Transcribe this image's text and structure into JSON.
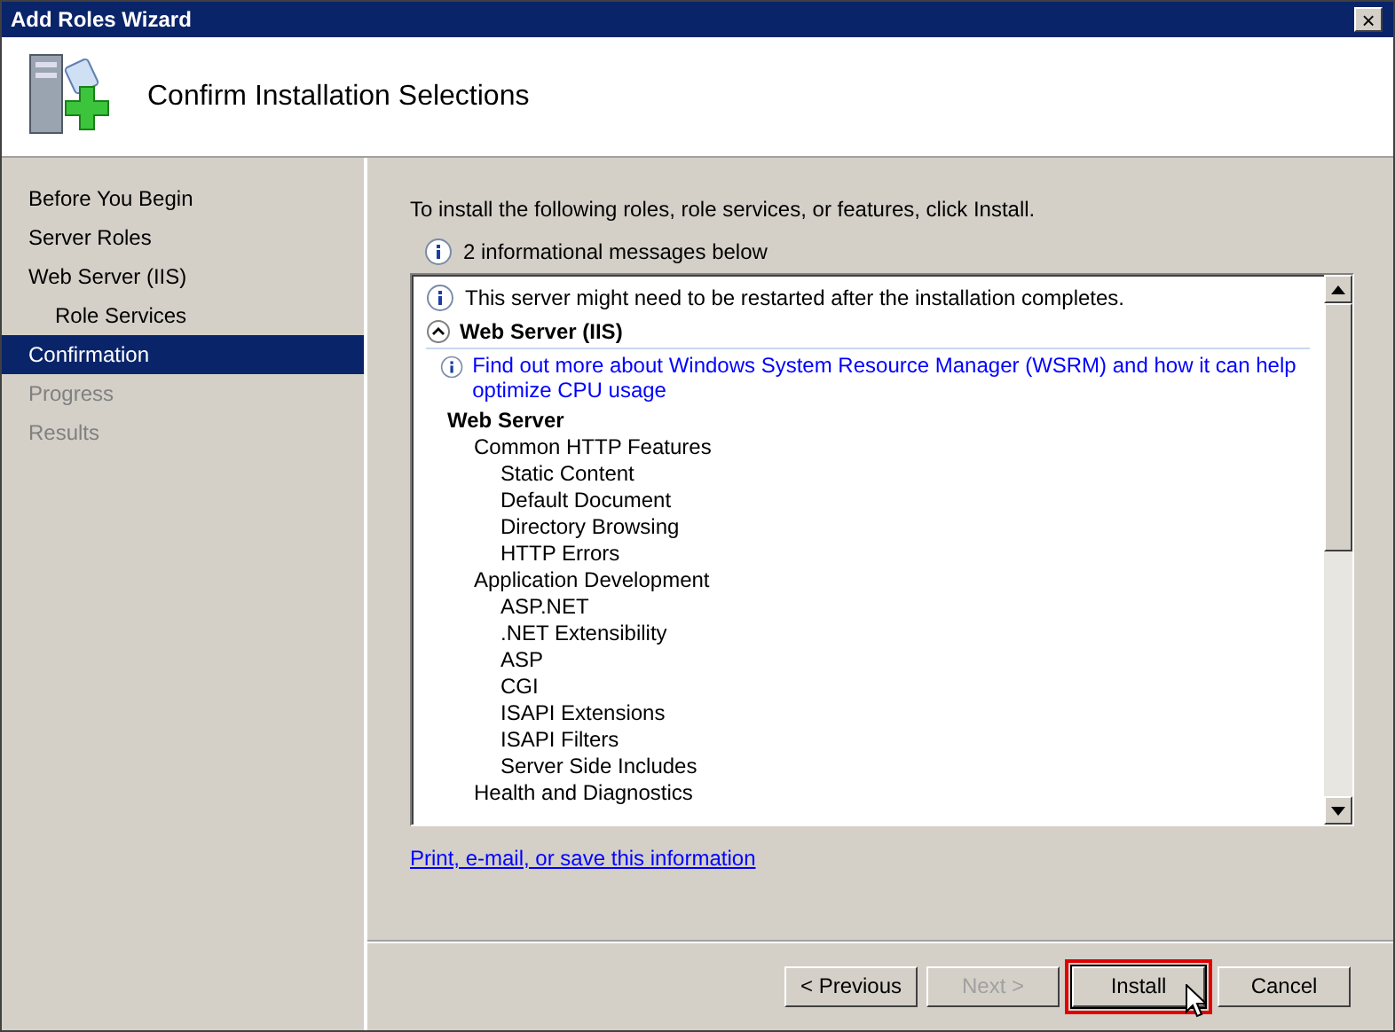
{
  "window": {
    "title": "Add Roles Wizard",
    "close": "×"
  },
  "header": {
    "title": "Confirm Installation Selections"
  },
  "sidebar": {
    "items": [
      {
        "label": "Before You Begin",
        "selected": false,
        "disabled": false
      },
      {
        "label": "Server Roles",
        "selected": false,
        "disabled": false
      },
      {
        "label": "Web Server (IIS)",
        "selected": false,
        "disabled": false,
        "children": [
          {
            "label": "Role Services",
            "selected": false,
            "disabled": false
          }
        ]
      },
      {
        "label": "Confirmation",
        "selected": true,
        "disabled": false
      },
      {
        "label": "Progress",
        "selected": false,
        "disabled": true
      },
      {
        "label": "Results",
        "selected": false,
        "disabled": true
      }
    ]
  },
  "intro": "To install the following roles, role services, or features, click Install.",
  "info_summary": "2 informational messages below",
  "details": {
    "notice": "This server might need to be restarted after the installation completes.",
    "section": {
      "title": "Web Server (IIS)",
      "expanded": true,
      "link": "Find out more about Windows System Resource Manager (WSRM) and how it can help optimize CPU usage",
      "tree": [
        {
          "label": "Web Server",
          "children": [
            {
              "label": "Common HTTP Features",
              "children": [
                {
                  "label": "Static Content"
                },
                {
                  "label": "Default Document"
                },
                {
                  "label": "Directory Browsing"
                },
                {
                  "label": "HTTP Errors"
                }
              ]
            },
            {
              "label": "Application Development",
              "children": [
                {
                  "label": "ASP.NET"
                },
                {
                  "label": ".NET Extensibility"
                },
                {
                  "label": "ASP"
                },
                {
                  "label": "CGI"
                },
                {
                  "label": "ISAPI Extensions"
                },
                {
                  "label": "ISAPI Filters"
                },
                {
                  "label": "Server Side Includes"
                }
              ]
            },
            {
              "label": "Health and Diagnostics"
            }
          ]
        }
      ]
    }
  },
  "footer_link": "Print, e-mail, or save this information",
  "buttons": [
    {
      "label": "< Previous",
      "disabled": false,
      "highlighted": false
    },
    {
      "label": "Next >",
      "disabled": true,
      "highlighted": false
    },
    {
      "label": "Install",
      "disabled": false,
      "highlighted": true
    },
    {
      "label": "Cancel",
      "disabled": false,
      "highlighted": false
    }
  ]
}
